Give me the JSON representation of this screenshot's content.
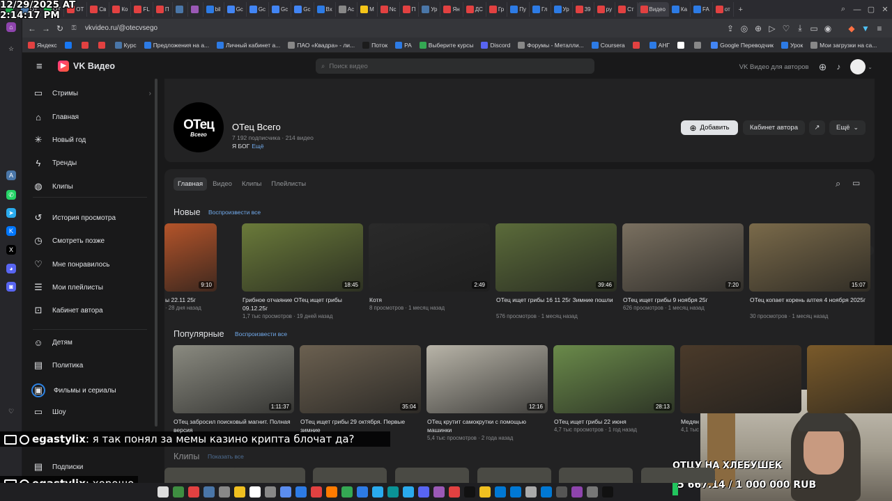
{
  "browser": {
    "tabs_left": [
      {
        "label": "",
        "color": "#1fa34a"
      },
      {
        "label": "ОТ",
        "color": "#4a76a8"
      },
      {
        "label": "ОТ",
        "color": "#1fa34a"
      },
      {
        "label": "ОТ",
        "color": "#e24141"
      },
      {
        "label": "Св",
        "color": "#e24141"
      },
      {
        "label": "Ко",
        "color": "#e24141"
      },
      {
        "label": "FL",
        "color": "#e24141"
      },
      {
        "label": "П",
        "color": "#e24141"
      },
      {
        "label": "",
        "color": "#4a76a8"
      },
      {
        "label": "",
        "color": "#9b59b6"
      },
      {
        "label": "bil",
        "color": "#2d7be5"
      },
      {
        "label": "Gc",
        "color": "#4285f4"
      },
      {
        "label": "Gc",
        "color": "#4285f4"
      },
      {
        "label": "Gc",
        "color": "#4285f4"
      },
      {
        "label": "Gc",
        "color": "#4285f4"
      },
      {
        "label": "Вх",
        "color": "#2d7be5"
      },
      {
        "label": "Ac",
        "color": "#888"
      },
      {
        "label": "M",
        "color": "#f5c518"
      },
      {
        "label": "Nc",
        "color": "#e24141"
      },
      {
        "label": "П",
        "color": "#e24141"
      },
      {
        "label": "Ур",
        "color": "#4a76a8"
      },
      {
        "label": "Ян",
        "color": "#e24141"
      },
      {
        "label": "ДС",
        "color": "#e24141"
      },
      {
        "label": "Гр",
        "color": "#e24141"
      },
      {
        "label": "Пу",
        "color": "#2d7be5"
      },
      {
        "label": "Гл",
        "color": "#2d7be5"
      },
      {
        "label": "Ур",
        "color": "#2d7be5"
      },
      {
        "label": "39",
        "color": "#e24141"
      },
      {
        "label": "py",
        "color": "#e24141"
      },
      {
        "label": "Ст",
        "color": "#e24141"
      },
      {
        "label": "Видео",
        "color": "#e24141",
        "active": true
      },
      {
        "label": "Ка",
        "color": "#2d7be5"
      },
      {
        "label": "FA",
        "color": "#2d7be5"
      },
      {
        "label": "от",
        "color": "#e24141"
      }
    ],
    "new_tab": "+",
    "url": "vkvideo.ru/@otecvsego",
    "bookmarks": [
      {
        "label": "Яндекс",
        "color": "#e24141"
      },
      {
        "label": "",
        "color": "#1877f2"
      },
      {
        "label": "",
        "color": "#e24141"
      },
      {
        "label": "",
        "color": "#e24141"
      },
      {
        "label": "Курс",
        "color": "#4a76a8"
      },
      {
        "label": "Предложения на а...",
        "color": "#2d7be5"
      },
      {
        "label": "Личный кабинет а...",
        "color": "#2d7be5"
      },
      {
        "label": "ПАО «Квадра» - ли...",
        "color": "#888"
      },
      {
        "label": "Поток",
        "color": "#1c1c1c"
      },
      {
        "label": "PA",
        "color": "#2d7be5"
      },
      {
        "label": "Выберите курсы",
        "color": "#34a853"
      },
      {
        "label": "Discord",
        "color": "#5865f2"
      },
      {
        "label": "Форумы - Металли...",
        "color": "#888"
      },
      {
        "label": "Coursera",
        "color": "#2d7be5"
      },
      {
        "label": "",
        "color": "#e24141"
      },
      {
        "label": "АНГ",
        "color": "#2d7be5"
      },
      {
        "label": "",
        "color": "#fff"
      },
      {
        "label": "",
        "color": "#888"
      },
      {
        "label": "Google Переводчик",
        "color": "#4285f4"
      },
      {
        "label": "Урок",
        "color": "#2d7be5"
      },
      {
        "label": "Мои загрузки на са...",
        "color": "#888"
      }
    ]
  },
  "header": {
    "logo": "VK Видео",
    "search_placeholder": "Поиск видео",
    "for_authors": "VK Видео для авторов"
  },
  "sidebar": {
    "items": [
      {
        "label": "Стримы",
        "icon": "live-icon"
      },
      {
        "label": "Главная",
        "icon": "home-icon"
      },
      {
        "label": "Новый год",
        "icon": "snowflake-icon"
      },
      {
        "label": "Тренды",
        "icon": "lightning-icon"
      },
      {
        "label": "Клипы",
        "icon": "clips-icon"
      },
      {
        "label": "История просмотра",
        "icon": "history-icon"
      },
      {
        "label": "Смотреть позже",
        "icon": "clock-icon"
      },
      {
        "label": "Мне понравилось",
        "icon": "heart-icon"
      },
      {
        "label": "Мои плейлисты",
        "icon": "playlist-icon"
      },
      {
        "label": "Кабинет автора",
        "icon": "author-icon"
      },
      {
        "label": "Детям",
        "icon": "kids-icon"
      },
      {
        "label": "Политика",
        "icon": "book-icon"
      },
      {
        "label": "Фильмы и сериалы",
        "icon": "films-icon"
      },
      {
        "label": "Шоу",
        "icon": "tv-icon"
      },
      {
        "label": "Подписки",
        "icon": "subscriptions-icon"
      }
    ]
  },
  "channel": {
    "avatar_text": "ОТец",
    "avatar_sub": "Всего",
    "name": "ОТец Всего",
    "stats": "7 192 подписчика · 214 видео",
    "desc": "Я БОГ",
    "desc_more": "Ещё",
    "btn_add": "Добавить",
    "btn_cabinet": "Кабинет автора",
    "btn_more": "Ещё"
  },
  "tabs": [
    "Главная",
    "Видео",
    "Клипы",
    "Плейлисты"
  ],
  "sections": {
    "new": {
      "title": "Новые",
      "play_all": "Воспроизвести все"
    },
    "popular": {
      "title": "Популярные",
      "play_all": "Воспроизвести все"
    },
    "clips": {
      "title": "Клипы",
      "show_all": "Показать все"
    }
  },
  "new_videos": [
    {
      "title": "ы 22.11 25г",
      "meta": "· 28 дня назад",
      "duration": "9:10",
      "thumb": "#b4542a"
    },
    {
      "title": "Грибное отчаяние ОТец ищет грибы 09.12.25г",
      "meta": "1,7 тыс просмотров · 19 дней назад",
      "duration": "18:45",
      "thumb": "#6a7a3a"
    },
    {
      "title": "Котя",
      "meta": "8 просмотров · 1 месяц назад",
      "duration": "2:49",
      "thumb": "#2a2a2a"
    },
    {
      "title": "ОТец ищет грибы 16 11 25г Зимние пошли",
      "meta": "576 просмотров · 1 месяц назад",
      "duration": "39:46",
      "thumb": "#5b6b3a"
    },
    {
      "title": "ОТец ищет грибы 9 ноября 25г",
      "meta": "626 просмотров · 1 месяц назад",
      "duration": "7:20",
      "thumb": "#7a7060"
    },
    {
      "title": "ОТец копает корень алтея 4 ноября 2025г",
      "meta": "30 просмотров · 1 месяц назад",
      "duration": "15:07",
      "thumb": "#7a6a4a"
    }
  ],
  "popular_videos": [
    {
      "title": "ОТец забросил поисковый магнит. Полная версия",
      "meta": "",
      "duration": "1:11:37",
      "thumb": "#8a8a80"
    },
    {
      "title": "ОТец ищет грибы 29 октября. Первые зимние",
      "meta": "",
      "duration": "35:04",
      "thumb": "#6b6050"
    },
    {
      "title": "ОТец крутит самокрутки с помощью машинки",
      "meta": "5,4 тыс просмотров · 2 года назад",
      "duration": "12:16",
      "thumb": "#b8b4a8"
    },
    {
      "title": "ОТец ищет грибы 22 июня",
      "meta": "4,7 тыс просмотров · 1 год назад",
      "duration": "28:13",
      "thumb": "#6a8a4a"
    },
    {
      "title": "Медян",
      "meta": "4,1 тыс",
      "duration": "",
      "thumb": "#4a3a2a"
    },
    {
      "title": "",
      "meta": "",
      "duration": "",
      "thumb": "#7a5a2a"
    }
  ],
  "overlay": {
    "clock_date": "12/29/2025 AT",
    "clock_time": "2:14:17 PM",
    "chat1_user": "egastylix",
    "chat1_text": ": я так понял за мемы казино крипта блочат да?",
    "chat2_user": "egastylix",
    "chat2_text": ": хорошо",
    "donation_title": "ОТЦУ НА ХЛЕБУШЕК",
    "donation_amount": "5 667.14 / 1 000 000 RUB",
    "donation_progress": 0.0057
  }
}
